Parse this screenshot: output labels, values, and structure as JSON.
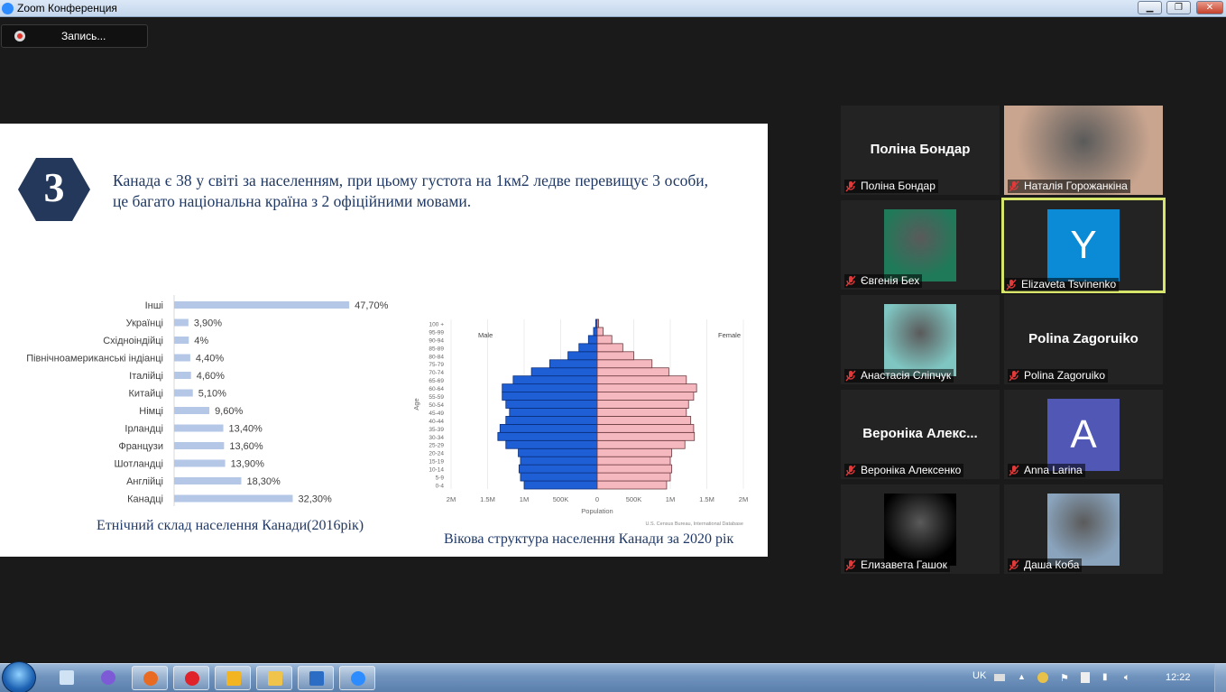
{
  "window": {
    "title": "Zoom Конференция",
    "min": "▁",
    "max": "❐",
    "close": "✕"
  },
  "recording": {
    "label": "Запись..."
  },
  "slide": {
    "number": "3",
    "headline": "Канада є 38 у світі за населенням, при цьому густота на 1км2 ледве перевищує 3 особи, це багато національна країна з 2 офіційними мовами.",
    "bar_caption": "Етнічний склад населення Канади(2016рік)",
    "pyramid_caption": "Вікова структура населення Канади за 2020 рік"
  },
  "chart_data": [
    {
      "type": "bar",
      "orientation": "horizontal",
      "categories": [
        "Інші",
        "Українці",
        "Східноіндійці",
        "Північноамериканські індіанці",
        "Італійці",
        "Китайці",
        "Німці",
        "Ірландці",
        "Французи",
        "Шотландці",
        "Англійці",
        "Канадці"
      ],
      "values": [
        47.7,
        3.9,
        4,
        4.4,
        4.6,
        5.1,
        9.6,
        13.4,
        13.6,
        13.9,
        18.3,
        32.3
      ],
      "value_labels": [
        "47,70%",
        "3,90%",
        "4%",
        "4,40%",
        "4,60%",
        "5,10%",
        "9,60%",
        "13,40%",
        "13,60%",
        "13,90%",
        "18,30%",
        "32,30%"
      ],
      "color": "#b4c7e7",
      "title": "Етнічний склад населення Канади(2016рік)"
    },
    {
      "type": "bar",
      "subtype": "population-pyramid",
      "categories": [
        "0-4",
        "5-9",
        "10-14",
        "15-19",
        "20-24",
        "25-29",
        "30-34",
        "35-39",
        "40-44",
        "45-49",
        "50-54",
        "55-59",
        "60-64",
        "65-69",
        "70-74",
        "75-79",
        "80-84",
        "85-89",
        "90-94",
        "95-99",
        "100 +"
      ],
      "series": [
        {
          "name": "Male",
          "color": "#1f5fd6",
          "values": [
            1.0,
            1.05,
            1.07,
            1.05,
            1.08,
            1.25,
            1.36,
            1.33,
            1.25,
            1.2,
            1.25,
            1.3,
            1.3,
            1.15,
            0.9,
            0.65,
            0.4,
            0.25,
            0.12,
            0.05,
            0.02
          ]
        },
        {
          "name": "Female",
          "color": "#f6b8bf",
          "values": [
            0.95,
            1.0,
            1.02,
            1.0,
            1.02,
            1.2,
            1.33,
            1.32,
            1.28,
            1.22,
            1.25,
            1.32,
            1.36,
            1.22,
            0.98,
            0.75,
            0.5,
            0.35,
            0.2,
            0.08,
            0.02
          ]
        }
      ],
      "xticks": [
        "2M",
        "1.5M",
        "1M",
        "500K",
        "0",
        "500K",
        "1M",
        "1.5M",
        "2M"
      ],
      "xlim": [
        -2,
        2
      ],
      "xlabel": "Population",
      "ylabel": "Age",
      "source": "U.S. Census Bureau, International Database",
      "title": "Вікова структура населення Канади за 2020 рік"
    }
  ],
  "participants": [
    {
      "name": "Поліна Бондар",
      "display": "Поліна Бондар",
      "type": "name"
    },
    {
      "name": "Наталія Горожанкіна",
      "type": "video",
      "bg": "#c9a58f"
    },
    {
      "name": "Євгенія Бех",
      "type": "video",
      "bg": "#1f7a5a"
    },
    {
      "name": "Elizaveta Tsvinenko",
      "letter": "Y",
      "type": "avatar",
      "bg": "#0b8ad6",
      "active": true
    },
    {
      "name": "Анастасія Сліпчук",
      "type": "video",
      "bg": "#7fc6c2"
    },
    {
      "name": "Polina Zagoruiko",
      "display": "Polina Zagoruiko",
      "type": "name"
    },
    {
      "name": "Вероніка Алексенко",
      "display": "Вероніка  Алекс...",
      "type": "name"
    },
    {
      "name": "Anna Larina",
      "letter": "A",
      "type": "avatar",
      "bg": "#5057b5"
    },
    {
      "name": "Елизавета Гашок",
      "type": "video",
      "bg": "#000000"
    },
    {
      "name": "Даша Коба",
      "type": "video",
      "bg": "#8aa4bd"
    }
  ],
  "taskbar": {
    "items": [
      "explorer-docs",
      "viber",
      "firefox",
      "opera",
      "media-player",
      "folder",
      "word",
      "zoom"
    ],
    "lang": "UK",
    "time": "12:22"
  },
  "colors": {
    "slide_text": "#1f3864",
    "hex": "#23385a",
    "active_border": "#d7e56a"
  }
}
